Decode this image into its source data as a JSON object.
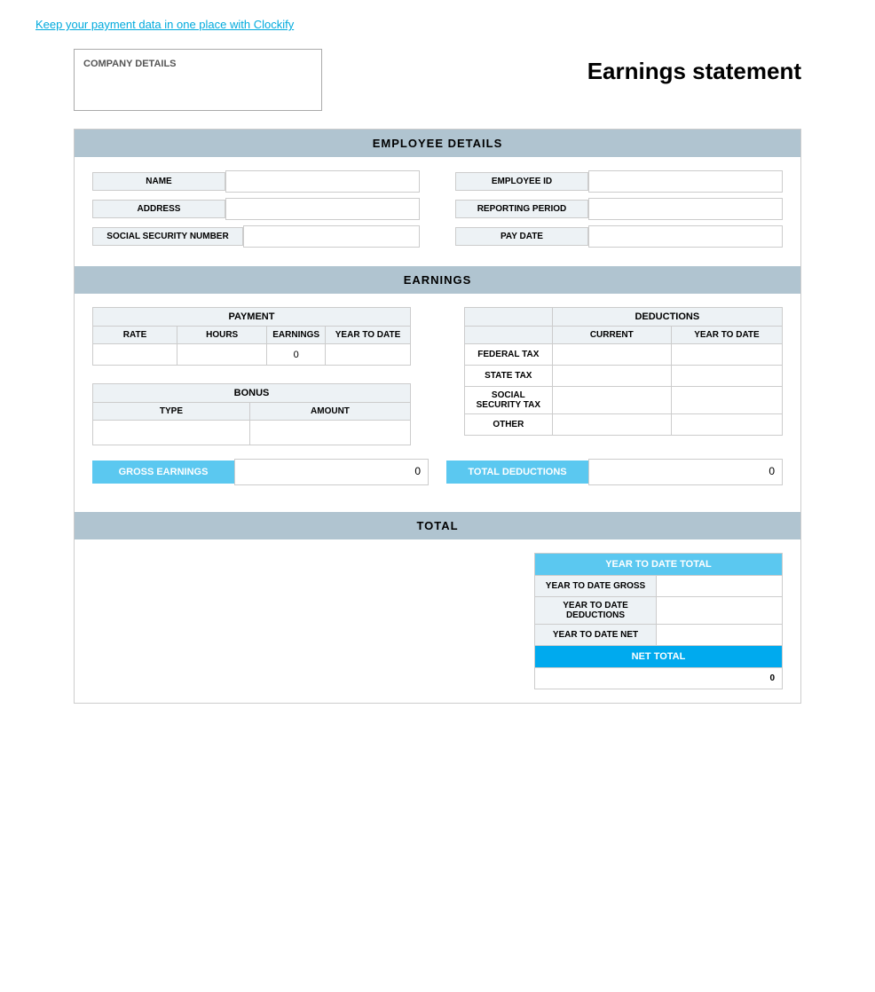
{
  "topLink": {
    "text": "Keep your payment data in one place with Clockify"
  },
  "header": {
    "companyLabel": "COMPANY DETAILS",
    "pageTitle": "Earnings statement"
  },
  "employeeSection": {
    "title": "EMPLOYEE DETAILS",
    "fields": {
      "name": "NAME",
      "address": "ADDRESS",
      "ssn": "SOCIAL SECURITY NUMBER",
      "employeeId": "EMPLOYEE ID",
      "reportingPeriod": "REPORTING PERIOD",
      "payDate": "PAY DATE"
    }
  },
  "earningsSection": {
    "title": "EARNINGS",
    "payment": {
      "header": "PAYMENT",
      "columns": [
        "RATE",
        "HOURS",
        "EARNINGS",
        "YEAR TO DATE"
      ],
      "row": {
        "rate": "",
        "hours": "",
        "earnings": "0",
        "ytd": ""
      }
    },
    "bonus": {
      "header": "BONUS",
      "columns": [
        "TYPE",
        "AMOUNT"
      ],
      "row": {
        "type": "",
        "amount": ""
      }
    },
    "deductions": {
      "header": "DEDUCTIONS",
      "columns": [
        "CURRENT",
        "YEAR TO DATE"
      ],
      "rows": [
        {
          "label": "FEDERAL TAX",
          "current": "",
          "ytd": ""
        },
        {
          "label": "STATE TAX",
          "current": "",
          "ytd": ""
        },
        {
          "label": "SOCIAL SECURITY TAX",
          "current": "",
          "ytd": ""
        },
        {
          "label": "OTHER",
          "current": "",
          "ytd": ""
        }
      ]
    },
    "grossEarnings": {
      "label": "GROSS EARNINGS",
      "value": "0"
    },
    "totalDeductions": {
      "label": "TOTAL DEDUCTIONS",
      "value": "0"
    }
  },
  "totalSection": {
    "title": "TOTAL",
    "ytdTable": {
      "header": "YEAR TO DATE TOTAL",
      "rows": [
        {
          "label": "YEAR TO DATE GROSS",
          "value": ""
        },
        {
          "label": "YEAR TO DATE DEDUCTIONS",
          "value": ""
        },
        {
          "label": "YEAR TO DATE NET",
          "value": ""
        }
      ]
    },
    "netTotal": {
      "label": "NET TOTAL",
      "value": "0"
    }
  }
}
